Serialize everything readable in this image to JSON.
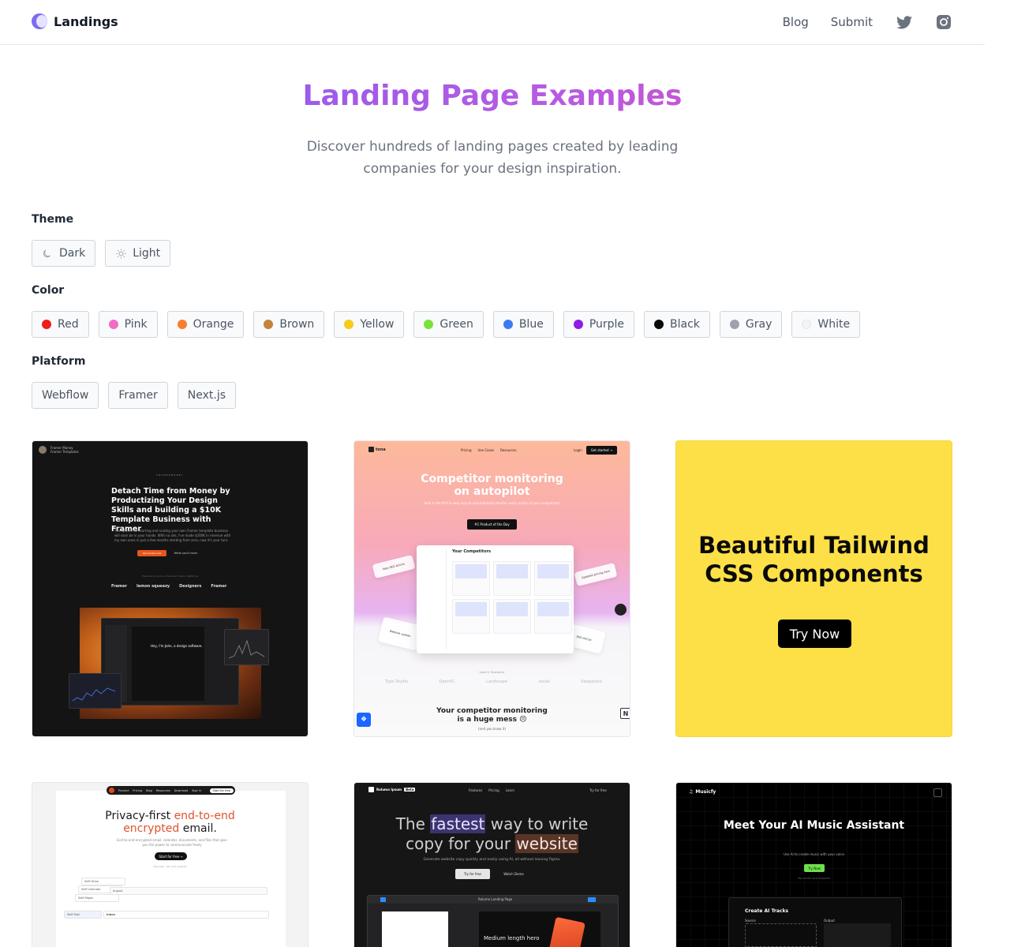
{
  "header": {
    "brand": "Landings",
    "nav": {
      "blog": "Blog",
      "submit": "Submit"
    }
  },
  "hero": {
    "title": "Landing Page Examples",
    "subtitle": "Discover hundreds of landing pages created by leading companies for your design inspiration."
  },
  "filters": {
    "theme": {
      "label": "Theme",
      "options": [
        {
          "label": "Dark",
          "icon": "moon-icon"
        },
        {
          "label": "Light",
          "icon": "sun-icon"
        }
      ]
    },
    "color": {
      "label": "Color",
      "options": [
        {
          "label": "Red",
          "swatch": "#ef1c1c"
        },
        {
          "label": "Pink",
          "swatch": "#f06dc4"
        },
        {
          "label": "Orange",
          "swatch": "#f77f2d"
        },
        {
          "label": "Brown",
          "swatch": "#c4843d"
        },
        {
          "label": "Yellow",
          "swatch": "#f5cc18"
        },
        {
          "label": "Green",
          "swatch": "#7be03b"
        },
        {
          "label": "Blue",
          "swatch": "#3b7bf0"
        },
        {
          "label": "Purple",
          "swatch": "#8e1ee6"
        },
        {
          "label": "Black",
          "swatch": "#0a0a0a"
        },
        {
          "label": "Gray",
          "swatch": "#9ca3af"
        },
        {
          "label": "White",
          "swatch": "#f3f4f6"
        }
      ]
    },
    "platform": {
      "label": "Platform",
      "options": [
        "Webflow",
        "Framer",
        "Next.js"
      ]
    }
  },
  "cards": {
    "framer": {
      "nav_name": "Framer Money",
      "nav_sub": "Framer Templates",
      "kicker": "FRAMERMONEY",
      "headline": "Detach Time from Money by Productizing Your Design Skills and building a $10K Template Business with Framer",
      "body": "The system for starting and scaling your own Framer template business will soon be in your hands. With no ads, I've made $200K in revenue with my own ones in just a few months starting from zero, now it's your turn.",
      "cta_primary": "Get access now",
      "cta_secondary": "What you'll learn",
      "caption": "Featured by some of the best creator platforms",
      "logos": [
        "Framer",
        "lemon squeezy",
        "Designers",
        "Framer"
      ],
      "window_text": "Hey, I'm John, a design software."
    },
    "tona": {
      "brand": "tona",
      "nav_links": [
        "Pricing",
        "Use Cases",
        "Resources"
      ],
      "login": "Login",
      "cta": "Get started →",
      "headline_line1": "Competitor monitoring",
      "headline_line2": "on autopilot",
      "subtext": "tona is the first & easy way to automatically monitor every action of your competitors",
      "badge": "#1 Product of the Day",
      "app_title": "Your Competitors",
      "float_left": "New SEO Article",
      "float_right": "Updated pricing tiers",
      "float_bl": "Website update",
      "float_br": "SEO Article",
      "used_by": "Used & Trusted by",
      "logos": [
        "Type Studio",
        "OpenVC",
        "Landscape",
        "social",
        "Swapstack"
      ],
      "footer_line1": "Your competitor monitoring",
      "footer_line2": "is a huge mess 😣",
      "footer_sub": "(and you know it)"
    },
    "ad": {
      "headline": "Beautiful Tailwind CSS Components",
      "cta": "Try Now"
    },
    "mail": {
      "nav_links": [
        "Product",
        "Pricing",
        "Blog",
        "Resources",
        "Download",
        "Sign in"
      ],
      "nav_cta": "Start for free",
      "headline_a": "Privacy-first ",
      "headline_b": "end-to-end",
      "headline_c": "encrypted",
      "headline_d": " email.",
      "body": "End-to-end encrypted email, calendar, documents, and files that give you the power to communicate freely",
      "cta": "Start for free →",
      "note": "Free plan · No card required",
      "rows": [
        "Skiff Drive",
        "Skiff Calendar",
        "Skiff Pages",
        "August",
        "Inbox",
        "Skiff Mail"
      ]
    },
    "copy": {
      "brand": "Rolumo Ipsum",
      "beta": "Beta",
      "nav_links": [
        "Features",
        "Pricing",
        "Learn"
      ],
      "try": "Try for free",
      "headline_a": "The ",
      "headline_b": "fastest",
      "headline_c": " way to write",
      "headline_d": "copy for your ",
      "headline_e": "website",
      "subtext": "Generate website copy quickly and easily using AI, all without leaving Figma.",
      "cta_primary": "Try for free",
      "cta_secondary": "Watch Demo",
      "editor_label": "Rolumo Landing Page",
      "canvas_text": "Medium length hero"
    },
    "music": {
      "brand": "Musicfy",
      "headline": "Meet Your AI Music Assistant",
      "subtext": "Use AI to create music with your voice",
      "cta": "Try Now",
      "note": "No credit card required",
      "app_title": "Create AI Tracks",
      "source": "Source",
      "output": "Output"
    }
  }
}
